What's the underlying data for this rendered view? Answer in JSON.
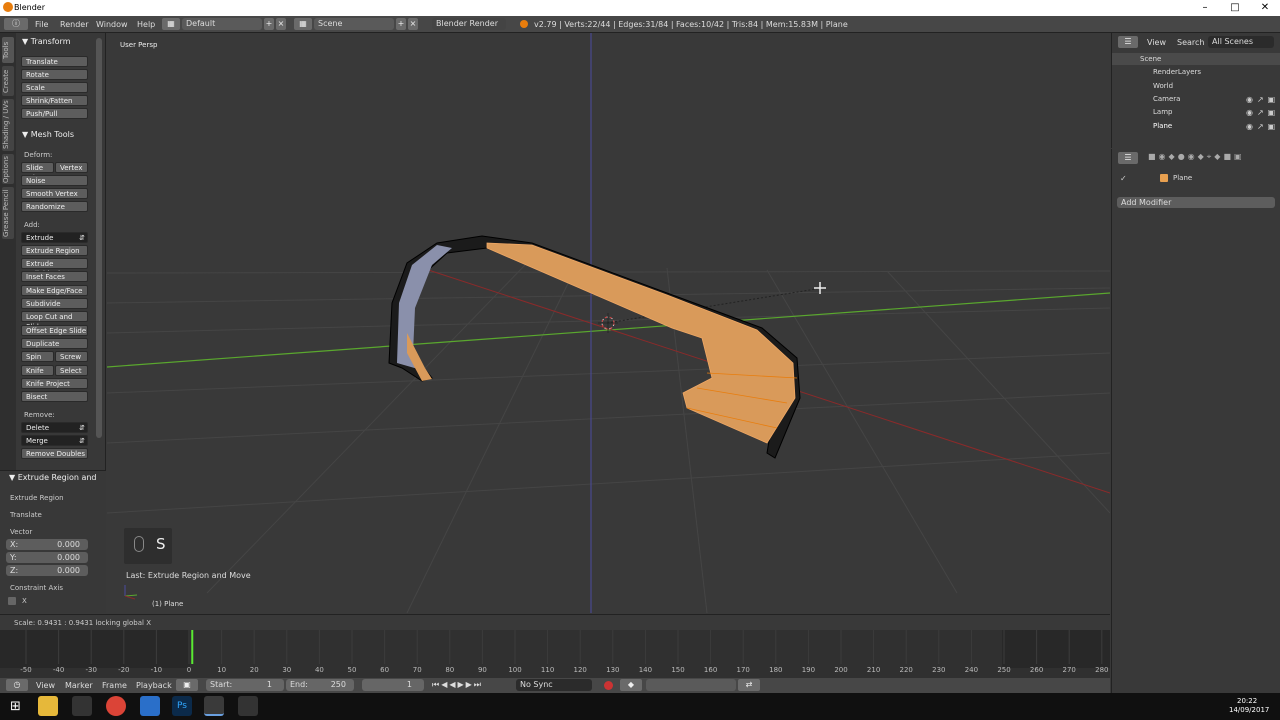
{
  "window": {
    "title": "Blender"
  },
  "menu": {
    "file": "File",
    "render": "Render",
    "window": "Window",
    "help": "Help",
    "layout": "Default",
    "scene": "Scene",
    "engine": "Blender Render",
    "stats": "v2.79 | Verts:22/44 | Edges:31/84 | Faces:10/42 | Tris:84 | Mem:15.83M | Plane"
  },
  "tabs": [
    "Tools",
    "Create",
    "Shading / UVs",
    "Options",
    "Grease Pencil"
  ],
  "tools": {
    "transform_header": "Transform",
    "transform": [
      "Translate",
      "Rotate",
      "Scale",
      "Shrink/Fatten",
      "Push/Pull"
    ],
    "mesh_header": "Mesh Tools",
    "deform_label": "Deform:",
    "slide_edge": "Slide Ed",
    "vertex": "Vertex",
    "deform": [
      "Noise",
      "Smooth Vertex",
      "Randomize"
    ],
    "add_label": "Add:",
    "extrude": "Extrude",
    "add": [
      "Extrude Region",
      "Extrude Individual",
      "Inset Faces",
      "Make Edge/Face",
      "Subdivide",
      "Loop Cut and Slide",
      "Offset Edge Slide",
      "Duplicate"
    ],
    "spin": "Spin",
    "screw": "Screw",
    "knife": "Knife",
    "select": "Select",
    "knife_project": "Knife Project",
    "bisect": "Bisect",
    "remove_label": "Remove:",
    "delete": "Delete",
    "merge": "Merge",
    "remove_doubles": "Remove Doubles"
  },
  "operator": {
    "header": "Extrude Region and",
    "extrude_region": "Extrude Region",
    "translate": "Translate",
    "vector_label": "Vector",
    "x": "X:",
    "x_val": "0.000",
    "y": "Y:",
    "y_val": "0.000",
    "z": "Z:",
    "z_val": "0.000",
    "constraint": "Constraint Axis",
    "cx": "X"
  },
  "viewport": {
    "persp": "User Persp",
    "key": "S",
    "last_op": "Last: Extrude Region and Move",
    "object": "(1) Plane"
  },
  "status": {
    "text": "Scale: 0.9431 : 0.9431 locking global X"
  },
  "timeline": {
    "ticks": [
      "-50",
      "-40",
      "-30",
      "-20",
      "-10",
      "0",
      "10",
      "20",
      "30",
      "40",
      "50",
      "60",
      "70",
      "80",
      "90",
      "100",
      "110",
      "120",
      "130",
      "140",
      "150",
      "160",
      "170",
      "180",
      "190",
      "200",
      "210",
      "220",
      "230",
      "240",
      "250",
      "260",
      "270",
      "280"
    ],
    "view": "View",
    "marker": "Marker",
    "frame": "Frame",
    "playback": "Playback",
    "start_label": "Start:",
    "start": "1",
    "end_label": "End:",
    "end": "250",
    "current": "1",
    "sync": "No Sync",
    "current_frame": 1
  },
  "outliner": {
    "view": "View",
    "search": "Search",
    "filter": "All Scenes",
    "items": [
      "Scene",
      "RenderLayers",
      "World",
      "Camera",
      "Lamp",
      "Plane"
    ]
  },
  "properties": {
    "object": "Plane",
    "add_modifier": "Add Modifier"
  },
  "taskbar": {
    "time": "20:22",
    "date": "14/09/2017"
  },
  "colors": {
    "accent": "#e87d0d",
    "selected": "#f0a865",
    "x_axis": "#8b2a2a",
    "y_axis": "#5aa82e",
    "z_axis": "#4a4aa0"
  }
}
